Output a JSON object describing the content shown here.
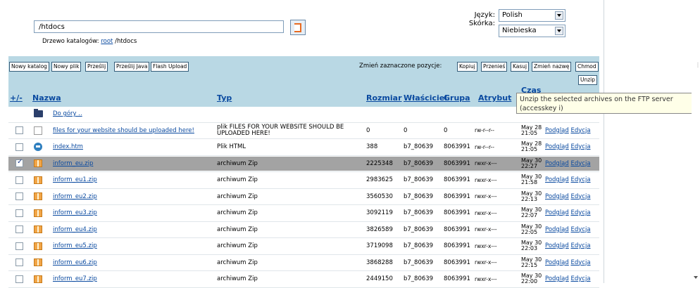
{
  "path": {
    "value": "/htdocs"
  },
  "tree": {
    "label": "Drzewo katalogów:",
    "root_link": "root",
    "current": "/htdocs"
  },
  "language": {
    "label": "Język:",
    "value": "Polish"
  },
  "skin": {
    "label": "Skórka:",
    "value": "Niebieska"
  },
  "toolbar": {
    "left_buttons": [
      "Nowy katalog",
      "Nowy plik",
      "Prześlij",
      "Prześlij Java",
      "Flash Upload"
    ],
    "selection_label": "Zmień zaznaczone pozycje:",
    "right_buttons": [
      "Kopiuj",
      "Przenieś",
      "Kasuj",
      "Zmień nazwę",
      "Chmod"
    ],
    "unzip": "Unzip"
  },
  "columns": {
    "toggle": "+/-",
    "name": "Nazwa",
    "type": "Typ",
    "size": "Rozmiar",
    "owner": "Właściciel",
    "group": "Grupa",
    "attributes": "Atrybut",
    "time": "Czas"
  },
  "rows": [
    {
      "name": "Do góry ..",
      "icon": "folder-up-icon",
      "type": "",
      "size": "",
      "owner": "",
      "group": "",
      "attr": "",
      "date1": "",
      "date2": "",
      "checked": false,
      "has_check": false
    },
    {
      "name": "files for your website should be uploaded here!",
      "icon": "file-icon",
      "type": "plik FILES FOR YOUR WEBSITE SHOULD BE UPLOADED HERE!",
      "size": "0",
      "owner": "0",
      "group": "0",
      "attr": "rw-r--r--",
      "date1": "May 28",
      "date2": "21:05",
      "checked": false,
      "has_check": true
    },
    {
      "name": "index.htm",
      "icon": "html-icon",
      "type": "Plik HTML",
      "size": "388",
      "owner": "b7_80639",
      "group": "8063991",
      "attr": "rw-r--r--",
      "date1": "May 28",
      "date2": "21:05",
      "checked": false,
      "has_check": true
    },
    {
      "name": "inform_eu.zip",
      "icon": "zip-icon",
      "type": "archiwum Zip",
      "size": "2225348",
      "owner": "b7_80639",
      "group": "8063991",
      "attr": "rwxr-x---",
      "date1": "May 30",
      "date2": "22:27",
      "checked": true,
      "has_check": true
    },
    {
      "name": "inform_eu1.zip",
      "icon": "zip-icon",
      "type": "archiwum Zip",
      "size": "2983625",
      "owner": "b7_80639",
      "group": "8063991",
      "attr": "rwxr-x---",
      "date1": "May 30",
      "date2": "21:58",
      "checked": false,
      "has_check": true
    },
    {
      "name": "inform_eu2.zip",
      "icon": "zip-icon",
      "type": "archiwum Zip",
      "size": "3560530",
      "owner": "b7_80639",
      "group": "8063991",
      "attr": "rwxr-x---",
      "date1": "May 30",
      "date2": "22:13",
      "checked": false,
      "has_check": true
    },
    {
      "name": "inform_eu3.zip",
      "icon": "zip-icon",
      "type": "archiwum Zip",
      "size": "3092119",
      "owner": "b7_80639",
      "group": "8063991",
      "attr": "rwxr-x---",
      "date1": "May 30",
      "date2": "22:07",
      "checked": false,
      "has_check": true
    },
    {
      "name": "inform_eu4.zip",
      "icon": "zip-icon",
      "type": "archiwum Zip",
      "size": "3826589",
      "owner": "b7_80639",
      "group": "8063991",
      "attr": "rwxr-x---",
      "date1": "May 30",
      "date2": "22:05",
      "checked": false,
      "has_check": true
    },
    {
      "name": "inform_eu5.zip",
      "icon": "zip-icon",
      "type": "archiwum Zip",
      "size": "3719098",
      "owner": "b7_80639",
      "group": "8063991",
      "attr": "rwxr-x---",
      "date1": "May 30",
      "date2": "22:03",
      "checked": false,
      "has_check": true
    },
    {
      "name": "inform_eu6.zip",
      "icon": "zip-icon",
      "type": "archiwum Zip",
      "size": "3868288",
      "owner": "b7_80639",
      "group": "8063991",
      "attr": "rwxr-x---",
      "date1": "May 30",
      "date2": "22:15",
      "checked": false,
      "has_check": true
    },
    {
      "name": "inform_eu7.zip",
      "icon": "zip-icon",
      "type": "archiwum Zip",
      "size": "2449150",
      "owner": "b7_80639",
      "group": "8063991",
      "attr": "rwxr-x---",
      "date1": "May 30",
      "date2": "22:00",
      "checked": false,
      "has_check": true
    }
  ],
  "row_actions": {
    "view": "Podgląd",
    "edit": "Edycja"
  },
  "tooltip": {
    "text": "Unzip the selected archives on the FTP server (accesskey i)"
  },
  "colors": {
    "header_bg": "#b9d8e4",
    "selected_row": "#a3a3a3",
    "link": "#0a4aa0"
  }
}
